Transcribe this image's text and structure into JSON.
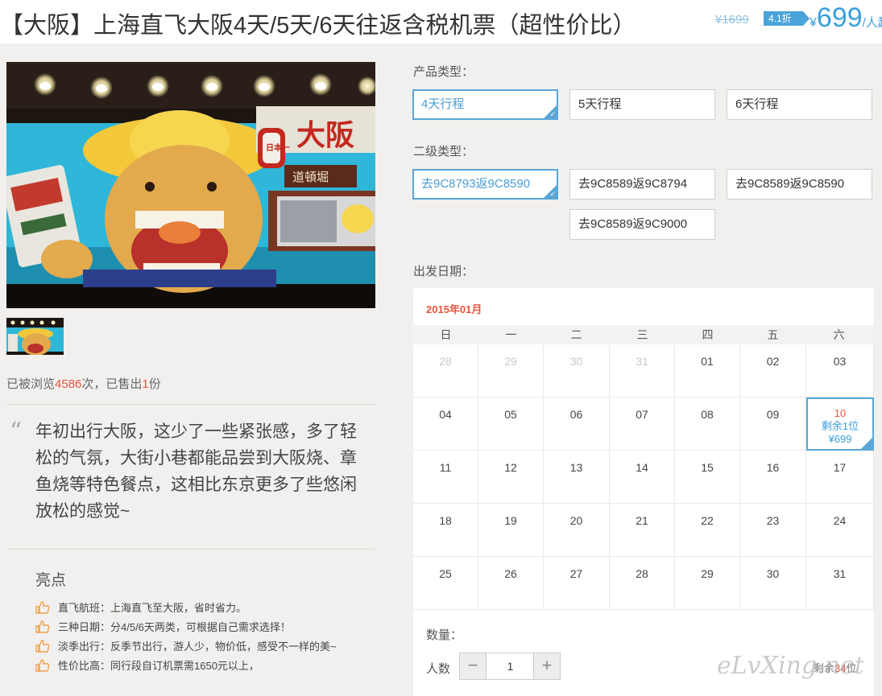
{
  "header": {
    "title": "【大阪】上海直飞大阪4天/5天/6天往返含税机票（超性价比）",
    "old_price": "¥1699",
    "discount": "4.1折",
    "price_currency": "¥",
    "price": "699",
    "price_unit": "/人起"
  },
  "gallery": {
    "main_sign_text": "大阪",
    "sub_sign_text": "道頓堀",
    "lantern_text": "日本一"
  },
  "stats": {
    "prefix": "已被浏览",
    "views": "4586",
    "middle": "次，已售出",
    "sold": "1",
    "suffix": "份"
  },
  "quote": {
    "mark": "“",
    "text": "年初出行大阪，这少了一些紧张感，多了轻松的气氛，大街小巷都能品尝到大阪烧、章鱼烧等特色餐点，这相比东京更多了些悠闲放松的感觉~"
  },
  "highlights": {
    "title": "亮点",
    "items": [
      "直飞航班：上海直飞至大阪，省时省力。",
      "三种日期：分4/5/6天两类，可根据自己需求选择！",
      "淡季出行：反季节出行，游人少，物价低，感受不一样的美~",
      "性价比高：同行段自订机票需1650元以上，"
    ]
  },
  "product_type": {
    "label": "产品类型：",
    "options": [
      "4天行程",
      "5天行程",
      "6天行程"
    ],
    "selected": 0
  },
  "sub_type": {
    "label": "二级类型：",
    "options": [
      "去9C8793返9C8590",
      "去9C8589返9C8794",
      "去9C8589返9C8590",
      "去9C8589返9C9000"
    ],
    "selected": 0
  },
  "departure": {
    "label": "出发日期：",
    "month": "2015年01月",
    "weekdays": [
      "日",
      "一",
      "二",
      "三",
      "四",
      "五",
      "六"
    ],
    "days": [
      "28",
      "29",
      "30",
      "31",
      "01",
      "02",
      "03",
      "04",
      "05",
      "06",
      "07",
      "08",
      "09",
      "10",
      "11",
      "12",
      "13",
      "14",
      "15",
      "16",
      "17",
      "18",
      "19",
      "20",
      "21",
      "22",
      "23",
      "24",
      "25",
      "26",
      "27",
      "28",
      "29",
      "30",
      "31"
    ],
    "available_day": "10",
    "available_rest": "剩余1位",
    "available_price": "¥699"
  },
  "quantity": {
    "label": "数量：",
    "people_label": "人数",
    "minus": "−",
    "plus": "+",
    "value": "1",
    "remain_prefix": "剩余",
    "remain_count": "34",
    "remain_suffix": "位"
  },
  "watermark": "eLvXing.net",
  "colors": {
    "accent": "#4aa4d9",
    "highlight": "#e8553e",
    "background": "#f1f0ee"
  }
}
